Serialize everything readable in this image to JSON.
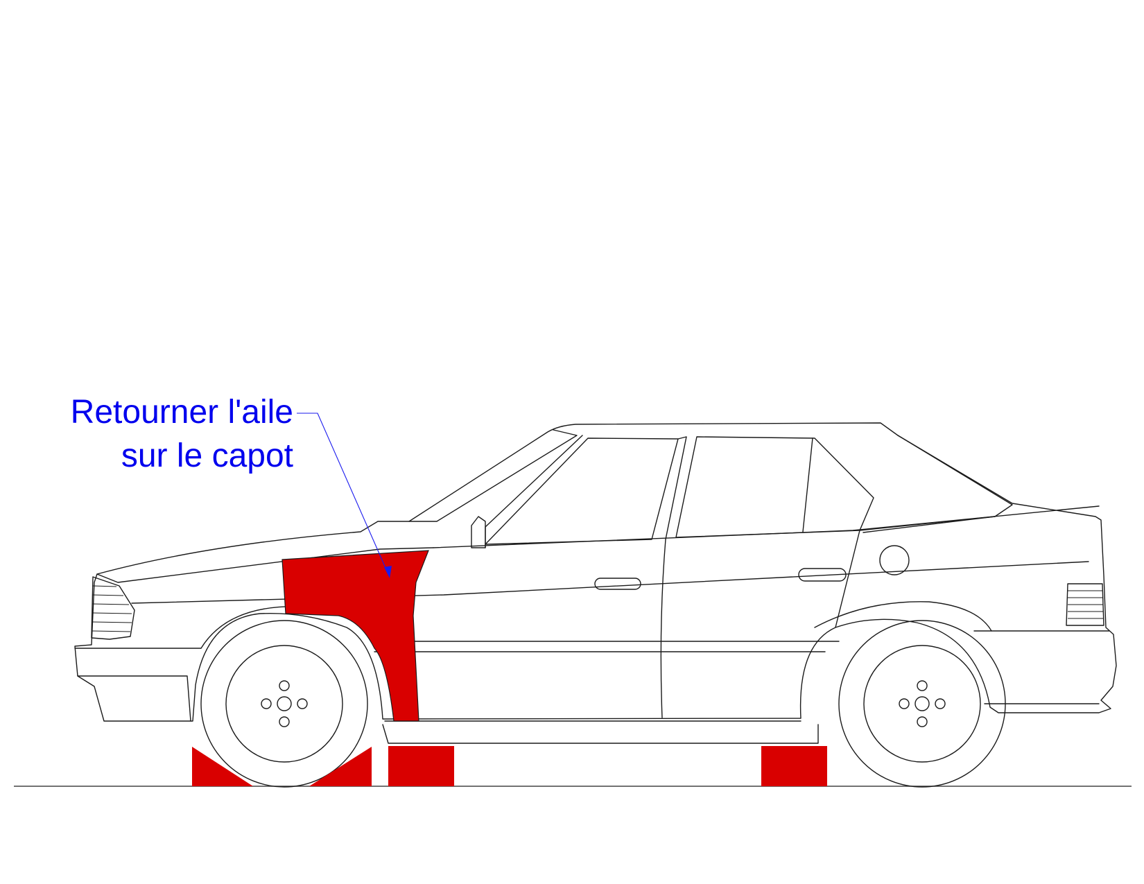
{
  "annotation": {
    "line1": "Retourner l'aile",
    "line2": "sur le capot",
    "color": "#0000ee"
  },
  "colors": {
    "highlight": "#d90000",
    "outline": "#1a1a1a",
    "background": "#ffffff"
  },
  "parts": {
    "front_wing": "highlighted",
    "wheel_chocks": 2,
    "support_blocks": 2
  }
}
